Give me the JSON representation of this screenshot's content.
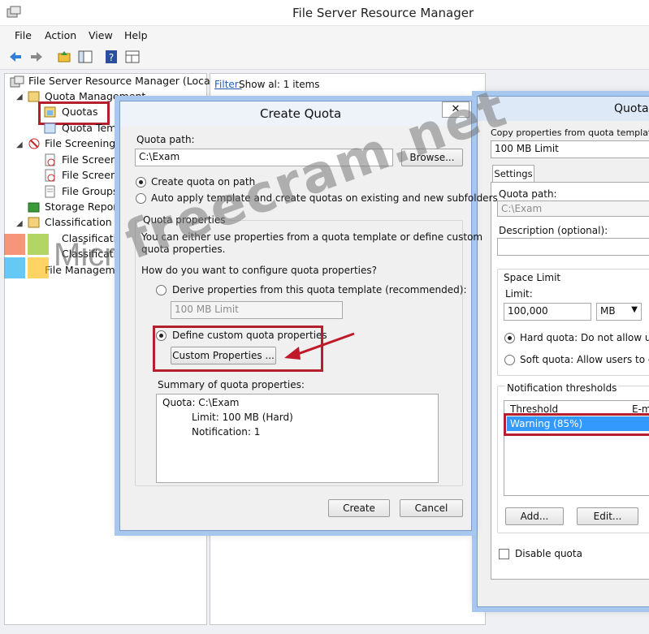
{
  "window": {
    "title": "File Server Resource Manager"
  },
  "menu": [
    "File",
    "Action",
    "View",
    "Help"
  ],
  "tree": {
    "root": "File Server Resource Manager (Local)",
    "quota_mgmt": "Quota Management",
    "quotas": "Quotas",
    "quota_templates": "Quota Temp",
    "file_screening": "File Screening M",
    "file_screens": "File Screens",
    "file_screen_templates": "File Screen T",
    "file_groups": "File Groups",
    "storage_reports": "Storage Reports",
    "classification": "Classification V",
    "classification_1": "Classificatio",
    "classification_2": "Classificatio",
    "file_management": "File Manageme"
  },
  "detail": {
    "filter_label": "Filter:",
    "filter_text": "Show al: 1 items"
  },
  "create_quota": {
    "title": "Create Quota",
    "close": "✕",
    "quota_path_label": "Quota path:",
    "quota_path_value": "C:\\Exam",
    "browse": "Browse...",
    "radio_create": "Create quota on path",
    "radio_auto": "Auto apply template and create quotas on existing and new subfolders",
    "props_group": "Quota properties",
    "props_desc_1": "You can either use properties from a quota template or define custom",
    "props_desc_2": "quota properties.",
    "how_label": "How do you want to configure quota properties?",
    "radio_derive": "Derive properties from this quota template (recommended):",
    "template_value": "100 MB Limit",
    "radio_define": "Define custom quota properties",
    "custom_btn": "Custom Properties ...",
    "summary_label": "Summary of quota properties:",
    "summary_root": "Quota: C:\\Exam",
    "summary_limit": "Limit: 100 MB (Hard)",
    "summary_notif": "Notification: 1",
    "create_btn": "Create",
    "cancel_btn": "Cancel"
  },
  "quota_props": {
    "title": "Quota",
    "copy_label": "Copy properties from quota template (o",
    "copy_value": "100 MB Limit",
    "tab_settings": "Settings",
    "quota_path_label": "Quota path:",
    "quota_path_value": "C:\\Exam",
    "desc_label": "Description (optional):",
    "space_limit": "Space Limit",
    "limit_label": "Limit:",
    "limit_value": "100,000",
    "unit_value": "MB",
    "hard_quota": "Hard quota: Do not allow users",
    "soft_quota": "Soft quota: Allow users to exce",
    "notif_label": "Notification thresholds",
    "col_threshold": "Threshold",
    "col_email": "E-ma",
    "row_warning": "Warning (85%)",
    "add_btn": "Add...",
    "edit_btn": "Edit...",
    "disable_quota": "Disable quota"
  },
  "watermark": "freecram.net",
  "ms_text": "Microsoft"
}
